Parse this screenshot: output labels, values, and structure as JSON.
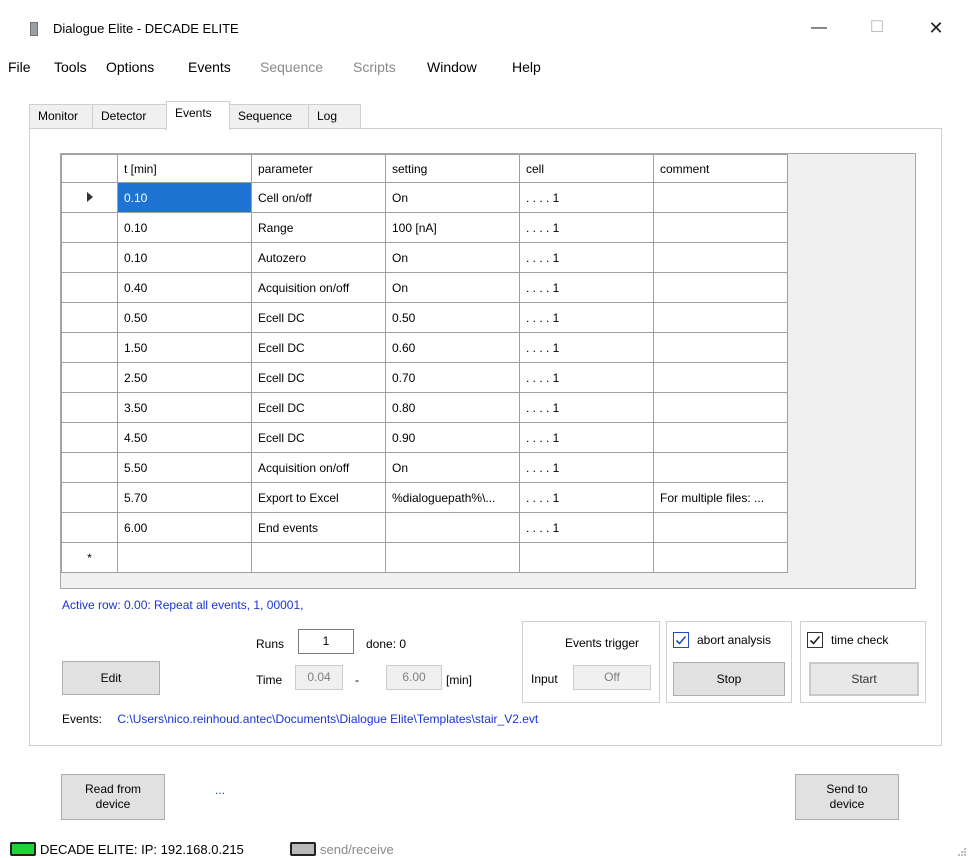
{
  "window": {
    "title": "Dialogue Elite - DECADE ELITE",
    "minimize_glyph": "—",
    "maximize_glyph": "☐",
    "close_glyph": "✕"
  },
  "menu": [
    {
      "label": "File",
      "enabled": true
    },
    {
      "label": "Tools",
      "enabled": true
    },
    {
      "label": "Options",
      "enabled": true
    },
    {
      "label": "Events",
      "enabled": true
    },
    {
      "label": "Sequence",
      "enabled": false
    },
    {
      "label": "Scripts",
      "enabled": false
    },
    {
      "label": "Window",
      "enabled": true
    },
    {
      "label": "Help",
      "enabled": true
    }
  ],
  "tabs": [
    {
      "label": "Monitor"
    },
    {
      "label": "Detector"
    },
    {
      "label": "Events",
      "active": true
    },
    {
      "label": "Sequence"
    },
    {
      "label": "Log"
    }
  ],
  "grid": {
    "columns": [
      "t [min]",
      "parameter",
      "setting",
      "cell",
      "comment"
    ],
    "rows": [
      [
        "0.10",
        "Cell on/off",
        "On",
        ". . . . 1",
        ""
      ],
      [
        "0.10",
        "Range",
        "100 [nA]",
        ". . . . 1",
        ""
      ],
      [
        "0.10",
        "Autozero",
        "On",
        ". . . . 1",
        ""
      ],
      [
        "0.40",
        "Acquisition on/off",
        "On",
        ". . . . 1",
        ""
      ],
      [
        "0.50",
        "Ecell DC",
        "0.50",
        ". . . . 1",
        ""
      ],
      [
        "1.50",
        "Ecell DC",
        "0.60",
        ". . . . 1",
        ""
      ],
      [
        "2.50",
        "Ecell DC",
        "0.70",
        ". . . . 1",
        ""
      ],
      [
        "3.50",
        "Ecell DC",
        "0.80",
        ". . . . 1",
        ""
      ],
      [
        "4.50",
        "Ecell DC",
        "0.90",
        ". . . . 1",
        ""
      ],
      [
        "5.50",
        "Acquisition on/off",
        "On",
        ". . . . 1",
        ""
      ],
      [
        "5.70",
        "Export to Excel",
        "%dialoguepath%\\...",
        ". . . . 1",
        "For multiple files: ..."
      ],
      [
        "6.00",
        "End events",
        "",
        ". . . . 1",
        ""
      ]
    ],
    "new_row_marker": "*"
  },
  "active_row_text": "Active row: 0.00: Repeat all events, 1, 00001,",
  "runs": {
    "label": "Runs",
    "value": "1",
    "done_label": "done: 0"
  },
  "time": {
    "label": "Time",
    "from": "0.04",
    "dash": "-",
    "to": "6.00",
    "unit": "[min]"
  },
  "edit_button": "Edit",
  "events_trigger": {
    "title": "Events trigger",
    "input_label": "Input",
    "input_value": "Off"
  },
  "abort": {
    "label": "abort analysis",
    "checked": true,
    "button": "Stop"
  },
  "time_check": {
    "label": "time check",
    "checked": true,
    "button": "Start"
  },
  "events_path": {
    "label": "Events:",
    "path": "C:\\Users\\nico.reinhoud.antec\\Documents\\Dialogue Elite\\Templates\\stair_V2.evt"
  },
  "read_button": "Read from\ndevice",
  "ellipsis": "...",
  "send_button": "Send to\ndevice",
  "status": {
    "device_text": "DECADE ELITE:  IP: 192.168.0.215",
    "send_receive": "send/receive"
  },
  "colors": {
    "accent": "#1f73d2",
    "link_text": "#1a33d6",
    "led_on": "#21d232",
    "led_off": "#b9b9b9"
  }
}
